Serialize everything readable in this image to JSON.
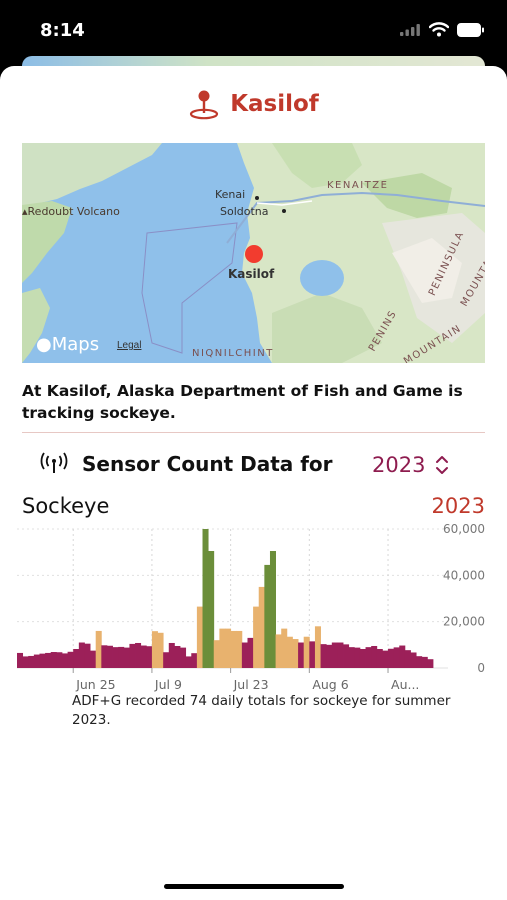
{
  "status_bar": {
    "time": "8:14"
  },
  "location": {
    "title": "Kasilof"
  },
  "map": {
    "labels": {
      "kenai": "Kenai",
      "soldotna": "Soldotna",
      "kenaitze": "KENAITZE",
      "redoubt": "Redoubt Volcano",
      "kasilof": "Kasilof",
      "peninsula": "PENINSULA",
      "mountains": "MOUNTAINS",
      "peninsula_fragment": "PENINS",
      "mountain_fragment": "MOUNTAIN",
      "ninilchik": "NIQNILCHINT"
    },
    "maps_logo": "Maps",
    "legal": "Legal"
  },
  "description": "At Kasilof, Alaska Department of Fish and Game is tracking sockeye.",
  "sensor": {
    "title": "Sensor Count Data for",
    "year": "2023"
  },
  "chart_header": {
    "species": "Sockeye",
    "year": "2023"
  },
  "caption": "ADF+G recorded 74 daily totals for sockeye for summer 2023.",
  "colors": {
    "maroon": "#9c2059",
    "tan": "#e8b26e",
    "green": "#6b8e3a",
    "accent_red": "#c0392b",
    "year_purple": "#8e1c4f"
  },
  "chart_data": {
    "type": "bar",
    "series": [
      {
        "name": "",
        "values": [
          6500,
          5000,
          5200,
          5800,
          6200,
          6500,
          6900,
          6800,
          6300,
          7000,
          8200,
          11000,
          10500,
          7500,
          16000,
          9800,
          9600,
          9000,
          9100,
          8800,
          10400,
          10800,
          9700,
          9400,
          15900,
          15200,
          6800,
          10800,
          9500,
          8800,
          5000,
          6400,
          26500,
          60000,
          50500,
          12000,
          17000,
          17000,
          16000,
          16000,
          11000,
          13000,
          26500,
          35000,
          44500,
          50500,
          14500,
          17000,
          13500,
          12500,
          11000,
          13500,
          11500,
          18000,
          10300,
          10000,
          11000,
          11000,
          10200,
          9000,
          8800,
          8200,
          9000,
          9500,
          8200,
          7500,
          8300,
          8900,
          9700,
          7700,
          6700,
          5100,
          4800,
          3800
        ]
      }
    ],
    "xlim": [
      "Jun 15",
      "Aug 27"
    ],
    "x_ticks": [
      "Jun 25",
      "Jul 9",
      "Jul 23",
      "Aug 6",
      "Au..."
    ],
    "y_ticks": [
      "60,000",
      "40,000",
      "20,000",
      "0"
    ],
    "ylim": [
      0,
      60000
    ],
    "grid": true
  }
}
